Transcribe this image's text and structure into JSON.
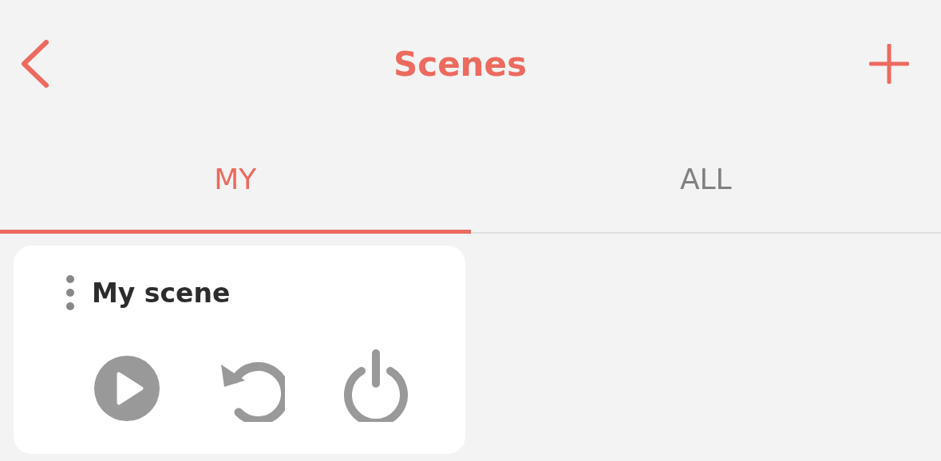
{
  "header": {
    "title": "Scenes"
  },
  "tabs": [
    {
      "label": "MY",
      "selected": true
    },
    {
      "label": "ALL",
      "selected": false
    }
  ],
  "scenes": [
    {
      "name": "My scene"
    }
  ]
}
